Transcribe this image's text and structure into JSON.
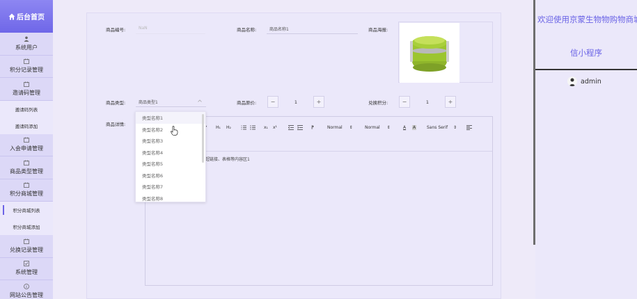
{
  "sidebar": {
    "logo": "后台首页",
    "items": [
      {
        "label": "系统用户",
        "icon": "user-icon"
      },
      {
        "label": "积分记录管理",
        "icon": "record-icon"
      },
      {
        "label": "邀请码管理",
        "icon": "record-icon"
      },
      {
        "label": "邀请码列表",
        "sub": true
      },
      {
        "label": "邀请码添加",
        "sub": true
      },
      {
        "label": "入会申请管理",
        "icon": "record-icon"
      },
      {
        "label": "商品类型管理",
        "icon": "record-icon"
      },
      {
        "label": "积分商城管理",
        "icon": "record-icon"
      },
      {
        "label": "积分商城列表",
        "sub": true,
        "active": true
      },
      {
        "label": "积分商城添加",
        "sub": true
      },
      {
        "label": "兑换记录管理",
        "icon": "record-icon"
      },
      {
        "label": "系统管理",
        "icon": "settings-icon"
      },
      {
        "label": "网站公告管理",
        "icon": "info-icon"
      }
    ]
  },
  "form": {
    "code_label": "商品编号:",
    "code_value": "NaN",
    "name_label": "商品名称:",
    "name_value": "商品名称1",
    "poster_label": "商品海报:",
    "type_label": "商品类型:",
    "type_value": "商品类型1",
    "price_label": "商品原价:",
    "price_value": "1",
    "points_label": "兑换积分:",
    "points_value": "1",
    "detail_label": "商品详情:"
  },
  "editor": {
    "toolbar": {
      "h1": "H₁",
      "h2": "H₂",
      "sub": "x₁",
      "sup": "x¹",
      "size1": "Normal",
      "size2": "Normal",
      "font": "Sans Serif"
    },
    "content": "、超链接、表格等内容区1"
  },
  "dropdown": {
    "options": [
      "类型名称1",
      "类型名称2",
      "类型名称3",
      "类型名称4",
      "类型名称5",
      "类型名称6",
      "类型名称7",
      "类型名称8"
    ]
  },
  "header": {
    "welcome": "欢迎使用京蒙生物物购物商城欢迎",
    "subtitle": "信小程序",
    "username": "admin"
  },
  "colors": {
    "accent": "#6a63e6",
    "sidebar": "#dcd8f7"
  }
}
